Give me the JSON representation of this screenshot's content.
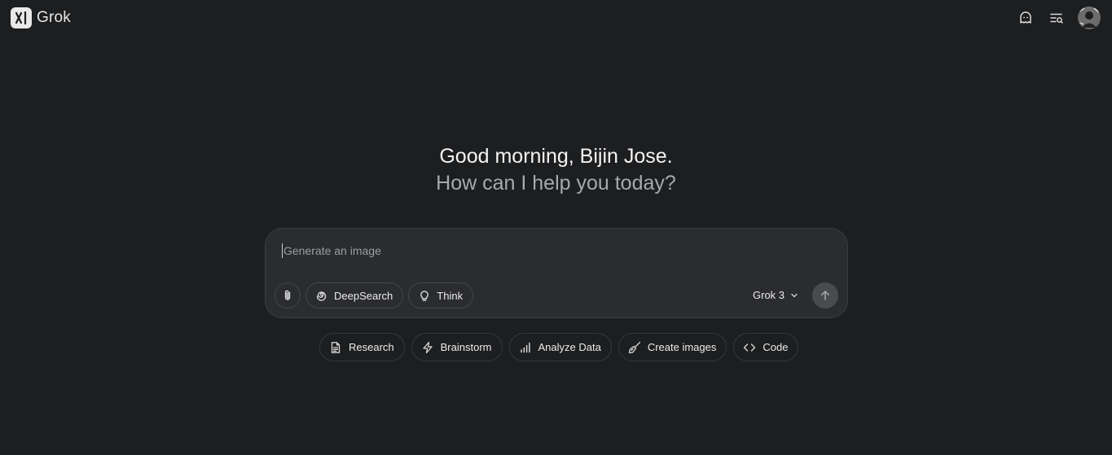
{
  "header": {
    "brand": "Grok",
    "icons": [
      "ghost-icon",
      "history-icon"
    ]
  },
  "greeting": {
    "line1": "Good morning, Bijin Jose.",
    "line2": "How can I help you today?"
  },
  "composer": {
    "placeholder": "Generate an image",
    "value": "",
    "tools": {
      "deepsearch": "DeepSearch",
      "think": "Think"
    },
    "model": "Grok 3"
  },
  "suggestions": [
    {
      "label": "Research",
      "icon": "document-icon"
    },
    {
      "label": "Brainstorm",
      "icon": "lightning-icon"
    },
    {
      "label": "Analyze Data",
      "icon": "bar-chart-icon"
    },
    {
      "label": "Create images",
      "icon": "brush-icon"
    },
    {
      "label": "Code",
      "icon": "code-icon"
    }
  ]
}
